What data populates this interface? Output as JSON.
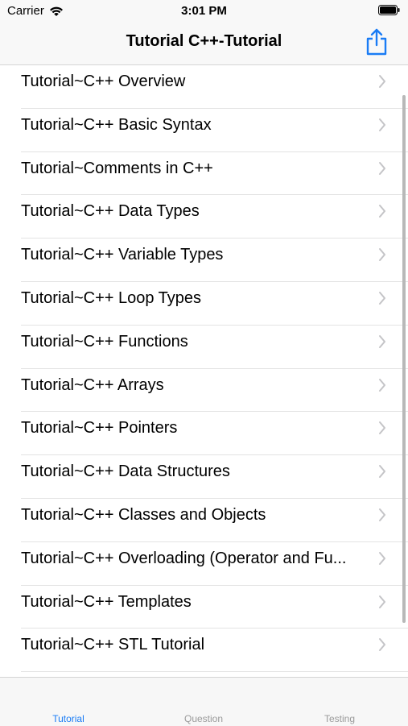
{
  "status_bar": {
    "carrier": "Carrier",
    "time": "3:01 PM"
  },
  "nav": {
    "title": "Tutorial C++-Tutorial",
    "share_icon": "share-icon",
    "accent_color": "#1a7cf5"
  },
  "list": {
    "items": [
      {
        "label": "Tutorial~C++ Overview"
      },
      {
        "label": "Tutorial~C++ Basic Syntax"
      },
      {
        "label": "Tutorial~Comments in C++"
      },
      {
        "label": "Tutorial~C++ Data Types"
      },
      {
        "label": "Tutorial~C++ Variable Types"
      },
      {
        "label": "Tutorial~C++ Loop Types"
      },
      {
        "label": "Tutorial~C++ Functions"
      },
      {
        "label": "Tutorial~C++ Arrays"
      },
      {
        "label": "Tutorial~C++ Pointers"
      },
      {
        "label": "Tutorial~C++ Data Structures"
      },
      {
        "label": "Tutorial~C++ Classes and Objects"
      },
      {
        "label": "Tutorial~C++ Overloading (Operator and Fu..."
      },
      {
        "label": "Tutorial~C++ Templates"
      },
      {
        "label": "Tutorial~C++ STL Tutorial"
      }
    ]
  },
  "tabs": [
    {
      "label": "Tutorial",
      "active": true
    },
    {
      "label": "Question",
      "active": false
    },
    {
      "label": "Testing",
      "active": false
    }
  ]
}
